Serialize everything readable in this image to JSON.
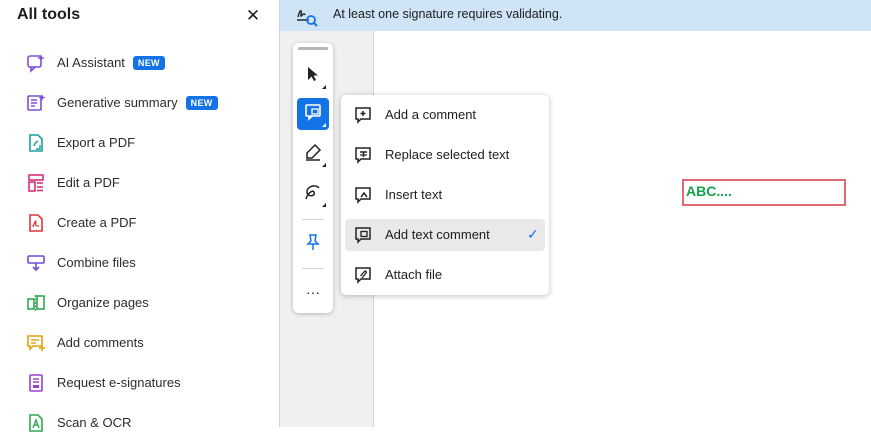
{
  "sidebar": {
    "title": "All tools",
    "close_glyph": "✕",
    "items": [
      {
        "label": "AI Assistant",
        "badge": "NEW",
        "icon": "ai-assistant-icon",
        "color": "#7b4fd6"
      },
      {
        "label": "Generative summary",
        "badge": "NEW",
        "icon": "generative-summary-icon",
        "color": "#7b4fd6"
      },
      {
        "label": "Export a PDF",
        "badge": "",
        "icon": "export-pdf-icon",
        "color": "#19a0a0"
      },
      {
        "label": "Edit a PDF",
        "badge": "",
        "icon": "edit-pdf-icon",
        "color": "#d9307a"
      },
      {
        "label": "Create a PDF",
        "badge": "",
        "icon": "create-pdf-icon",
        "color": "#e0343a"
      },
      {
        "label": "Combine files",
        "badge": "",
        "icon": "combine-files-icon",
        "color": "#6b4fd6"
      },
      {
        "label": "Organize pages",
        "badge": "",
        "icon": "organize-pages-icon",
        "color": "#2fa84f"
      },
      {
        "label": "Add comments",
        "badge": "",
        "icon": "add-comments-icon",
        "color": "#e5a00d"
      },
      {
        "label": "Request e-signatures",
        "badge": "",
        "icon": "request-esignatures-icon",
        "color": "#9b3fc9"
      },
      {
        "label": "Scan & OCR",
        "badge": "",
        "icon": "scan-ocr-icon",
        "color": "#2fa84f"
      }
    ]
  },
  "banner": {
    "text": "At least one signature requires validating.",
    "icon": "signature-validation-icon",
    "color": "#cfe5f7"
  },
  "toolbar": {
    "tools": [
      "select-tool",
      "comment-tool",
      "highlight-tool",
      "draw-tool",
      "stamp-tool",
      "more-tools"
    ],
    "active": "comment-tool",
    "more_glyph": "···"
  },
  "comment_menu": {
    "items": [
      {
        "label": "Add a comment",
        "icon": "add-comment-icon",
        "selected": false
      },
      {
        "label": "Replace selected text",
        "icon": "replace-text-icon",
        "selected": false
      },
      {
        "label": "Insert text",
        "icon": "insert-text-icon",
        "selected": false
      },
      {
        "label": "Add text comment",
        "icon": "text-comment-icon",
        "selected": true
      },
      {
        "label": "Attach file",
        "icon": "attach-file-icon",
        "selected": false
      }
    ],
    "check_glyph": "✓"
  },
  "document": {
    "annotation_text": "ABC....",
    "annotation_color": "#13a34a",
    "box_color": "#e06b76"
  },
  "colors": {
    "accent": "#1473e6"
  }
}
